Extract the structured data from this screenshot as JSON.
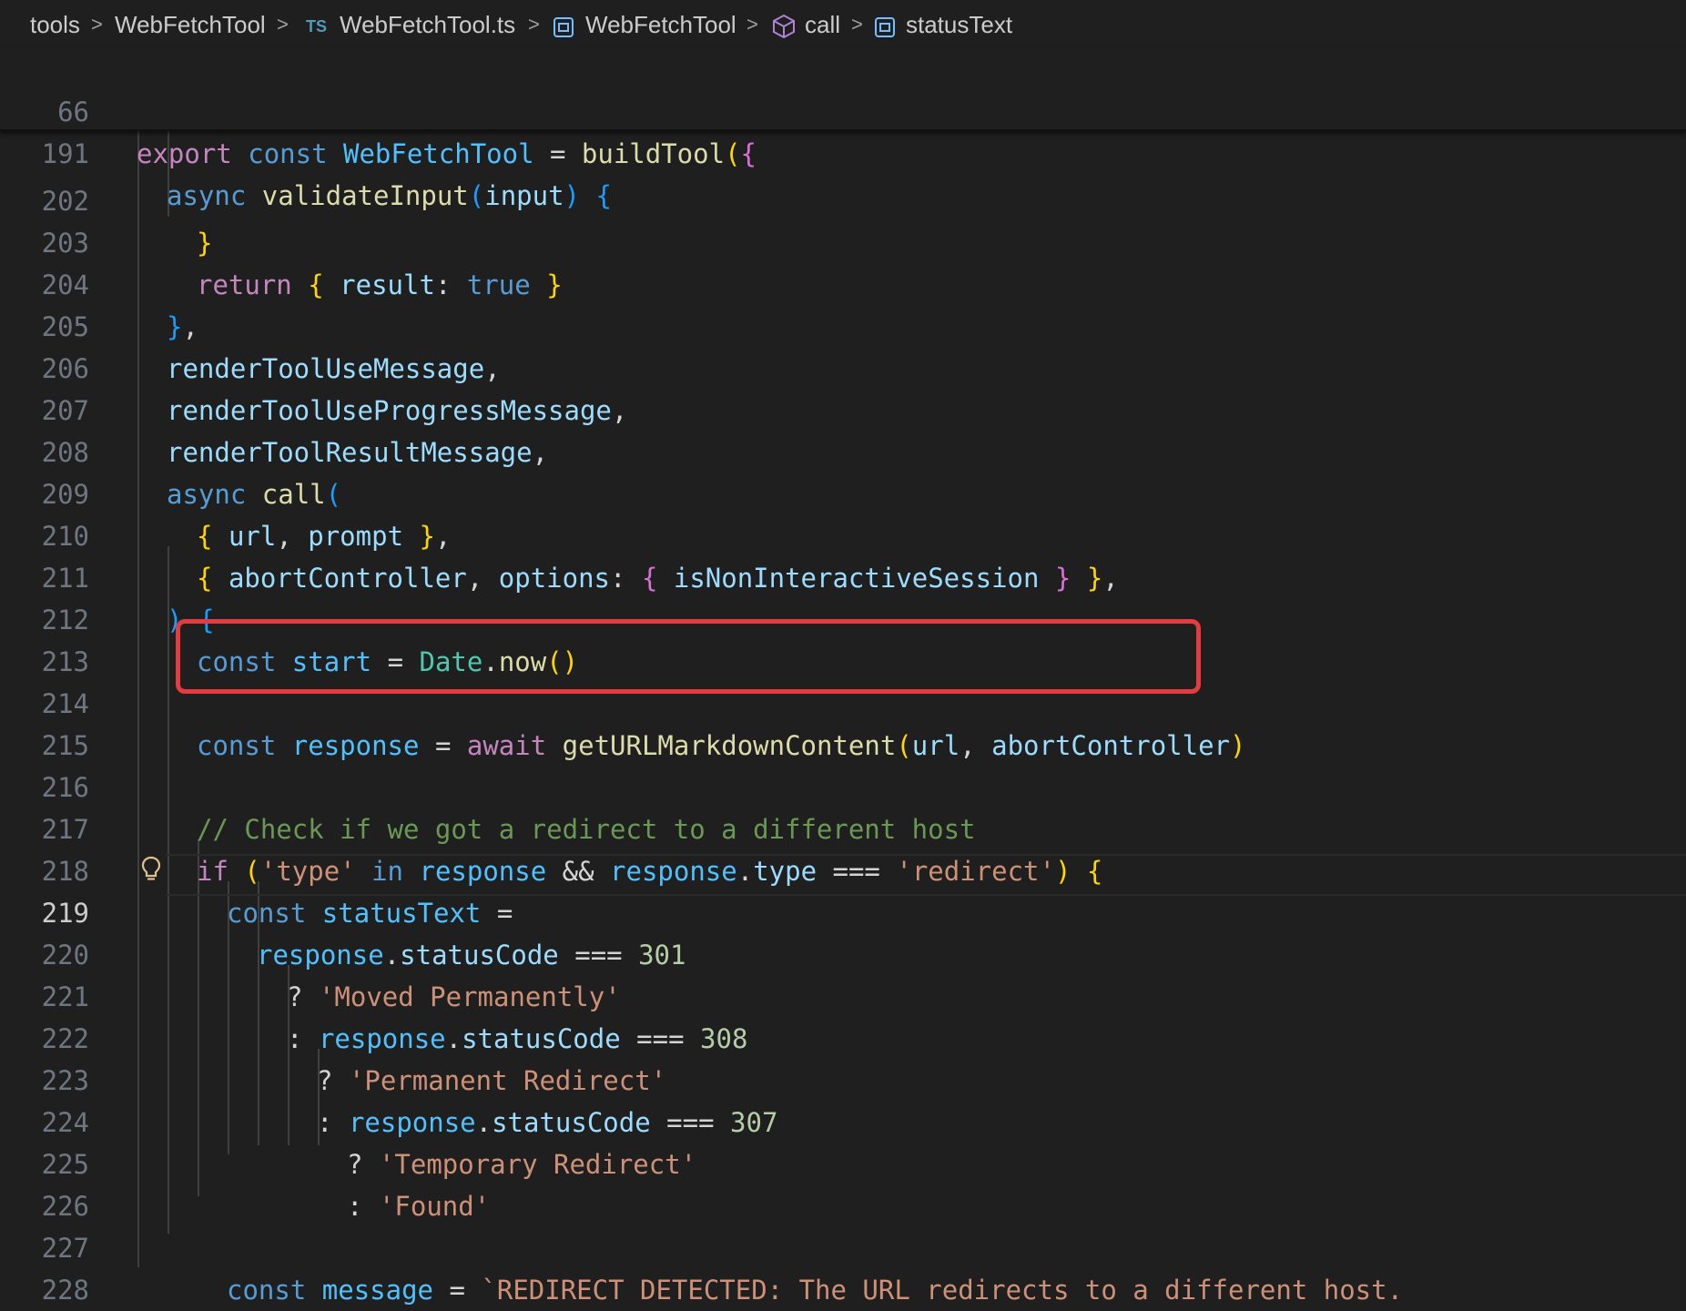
{
  "breadcrumb": {
    "items": [
      "tools",
      "WebFetchTool",
      "WebFetchTool.ts",
      "WebFetchTool",
      "call",
      "statusText"
    ],
    "ts_badge": "TS",
    "separator": ">"
  },
  "sticky": {
    "line_numbers": [
      "66",
      "191"
    ],
    "line66": {
      "export": "export",
      "const": "const",
      "name": "WebFetchTool",
      "eq": " = ",
      "fn": "buildTool",
      "open": "(",
      "brace": "{"
    },
    "line191": {
      "async": "async",
      "fn": "validateInput",
      "open": "(",
      "param": "input",
      "close": ")",
      "brace": "{"
    }
  },
  "editor": {
    "active_line": "219",
    "highlighted_line": "214",
    "line_numbers": [
      "202",
      "203",
      "204",
      "205",
      "206",
      "207",
      "208",
      "209",
      "210",
      "211",
      "212",
      "213",
      "214",
      "215",
      "216",
      "217",
      "218",
      "219",
      "220",
      "221",
      "222",
      "223",
      "224",
      "225",
      "226",
      "227",
      "228"
    ],
    "l203": {
      "kw": "return",
      "prop": "result",
      "val": "true"
    },
    "l205": "renderToolUseMessage",
    "l206": "renderToolUseProgressMessage",
    "l207": "renderToolResultMessage",
    "l208": {
      "kw": "async",
      "fn": "call"
    },
    "l209": {
      "a": "url",
      "b": "prompt"
    },
    "l210": {
      "a": "abortController",
      "b": "options",
      "c": "isNonInteractiveSession"
    },
    "l212": {
      "kw": "const",
      "name": "start",
      "cls": "Date",
      "fn": "now"
    },
    "l214": {
      "kw": "const",
      "name": "response",
      "await": "await",
      "fn": "getURLMarkdownContent",
      "a": "url",
      "b": "abortController"
    },
    "l216": "// Check if we got a redirect to a different host",
    "l217": {
      "kw": "if",
      "s1": "'type'",
      "in": "in",
      "obj": "response",
      "obj2": "response",
      "prop": "type",
      "s2": "'redirect'"
    },
    "l218": {
      "kw": "const",
      "name": "statusText"
    },
    "l219": {
      "obj": "response",
      "prop": "statusCode",
      "num": "301"
    },
    "l220": "'Moved Permanently'",
    "l221": {
      "obj": "response",
      "prop": "statusCode",
      "num": "308"
    },
    "l222": "'Permanent Redirect'",
    "l223": {
      "obj": "response",
      "prop": "statusCode",
      "num": "307"
    },
    "l224": "'Temporary Redirect'",
    "l225": "'Found'",
    "l227": {
      "kw": "const",
      "name": "message",
      "str": "`REDIRECT DETECTED: The URL redirects to a different host."
    }
  },
  "colors": {
    "background": "#1f1f1f",
    "highlight_box": "#e33b3f",
    "keyword": "#569cd6",
    "control": "#c586c0",
    "function": "#dcdcaa",
    "string": "#ce9178",
    "comment": "#6a9955"
  },
  "icons": [
    "ts-file-icon",
    "module-icon",
    "method-cube-icon",
    "variable-icon",
    "lightbulb-icon"
  ]
}
